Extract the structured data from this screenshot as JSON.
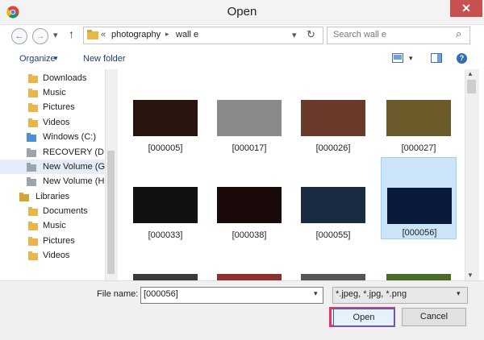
{
  "window": {
    "title": "Open",
    "close_glyph": "✕"
  },
  "nav": {
    "back_glyph": "←",
    "forward_glyph": "→",
    "recent_glyph": "▾",
    "up_glyph": "↑",
    "breadcrumb_prefix": "«",
    "breadcrumb": [
      "photography",
      "wall e"
    ],
    "separator": "▸",
    "dropdown_glyph": "▾",
    "refresh_glyph": "↻",
    "search_placeholder": "Search wall e",
    "search_glyph": "⌕"
  },
  "toolbar": {
    "organize_label": "Organize",
    "organize_arrow": "▾",
    "new_folder_label": "New folder",
    "view_arrow": "▾",
    "help_glyph": "?"
  },
  "sidebar": {
    "items": [
      {
        "label": "Downloads",
        "icon": "downloads-folder-icon"
      },
      {
        "label": "Music",
        "icon": "music-folder-icon"
      },
      {
        "label": "Pictures",
        "icon": "pictures-folder-icon"
      },
      {
        "label": "Videos",
        "icon": "videos-folder-icon"
      },
      {
        "label": "Windows (C:)",
        "icon": "windows-drive-icon"
      },
      {
        "label": "RECOVERY (D:)",
        "icon": "drive-icon"
      },
      {
        "label": "New Volume (G:)",
        "icon": "drive-icon",
        "selected": true
      },
      {
        "label": "New Volume (H:)",
        "icon": "drive-icon"
      },
      {
        "label": "Libraries",
        "icon": "libraries-icon"
      },
      {
        "label": "Documents",
        "icon": "documents-library-icon"
      },
      {
        "label": "Music",
        "icon": "music-library-icon"
      },
      {
        "label": "Pictures",
        "icon": "pictures-library-icon"
      },
      {
        "label": "Videos",
        "icon": "videos-library-icon"
      }
    ]
  },
  "files": [
    {
      "name": "[000005]",
      "thumb": "volcano-lava-thumbnail",
      "color": "#2a1410"
    },
    {
      "name": "[000017]",
      "thumb": "mushroom-cloud-thumbnail",
      "color": "#8a8a8a"
    },
    {
      "name": "[000026]",
      "thumb": "bench-bokeh-thumbnail",
      "color": "#6a3a2a"
    },
    {
      "name": "[000027]",
      "thumb": "mona-lisa-thumbnail",
      "color": "#6b5a2a"
    },
    {
      "name": "[000033]",
      "thumb": "sketch-figure-thumbnail",
      "color": "#111111"
    },
    {
      "name": "[000038]",
      "thumb": "joker-face-thumbnail",
      "color": "#1a0a0a"
    },
    {
      "name": "[000055]",
      "thumb": "city-night-thumbnail",
      "color": "#1a2a40"
    },
    {
      "name": "[000056]",
      "thumb": "planet-horizon-thumbnail",
      "color": "#0a1a3a",
      "selected": true
    },
    {
      "name": "",
      "thumb": "partial-thumbnail-1",
      "color": "#3a3a3a"
    },
    {
      "name": "",
      "thumb": "partial-thumbnail-2",
      "color": "#8a3030"
    },
    {
      "name": "",
      "thumb": "partial-thumbnail-3",
      "color": "#555555"
    },
    {
      "name": "",
      "thumb": "partial-thumbnail-4",
      "color": "#4a6a2a"
    }
  ],
  "footer": {
    "file_name_label": "File name:",
    "file_name_value": "[000056]",
    "file_name_arrow": "▾",
    "filter_value": "*.jpeg, *.jpg, *.png",
    "filter_arrow": "▾",
    "open_label": "Open",
    "cancel_label": "Cancel"
  },
  "colors": {
    "highlight_border": "#e8336b",
    "selection_fill": "#cce4f7",
    "folder_yellow": "#e8b64a",
    "link_blue": "#1e3f73"
  }
}
